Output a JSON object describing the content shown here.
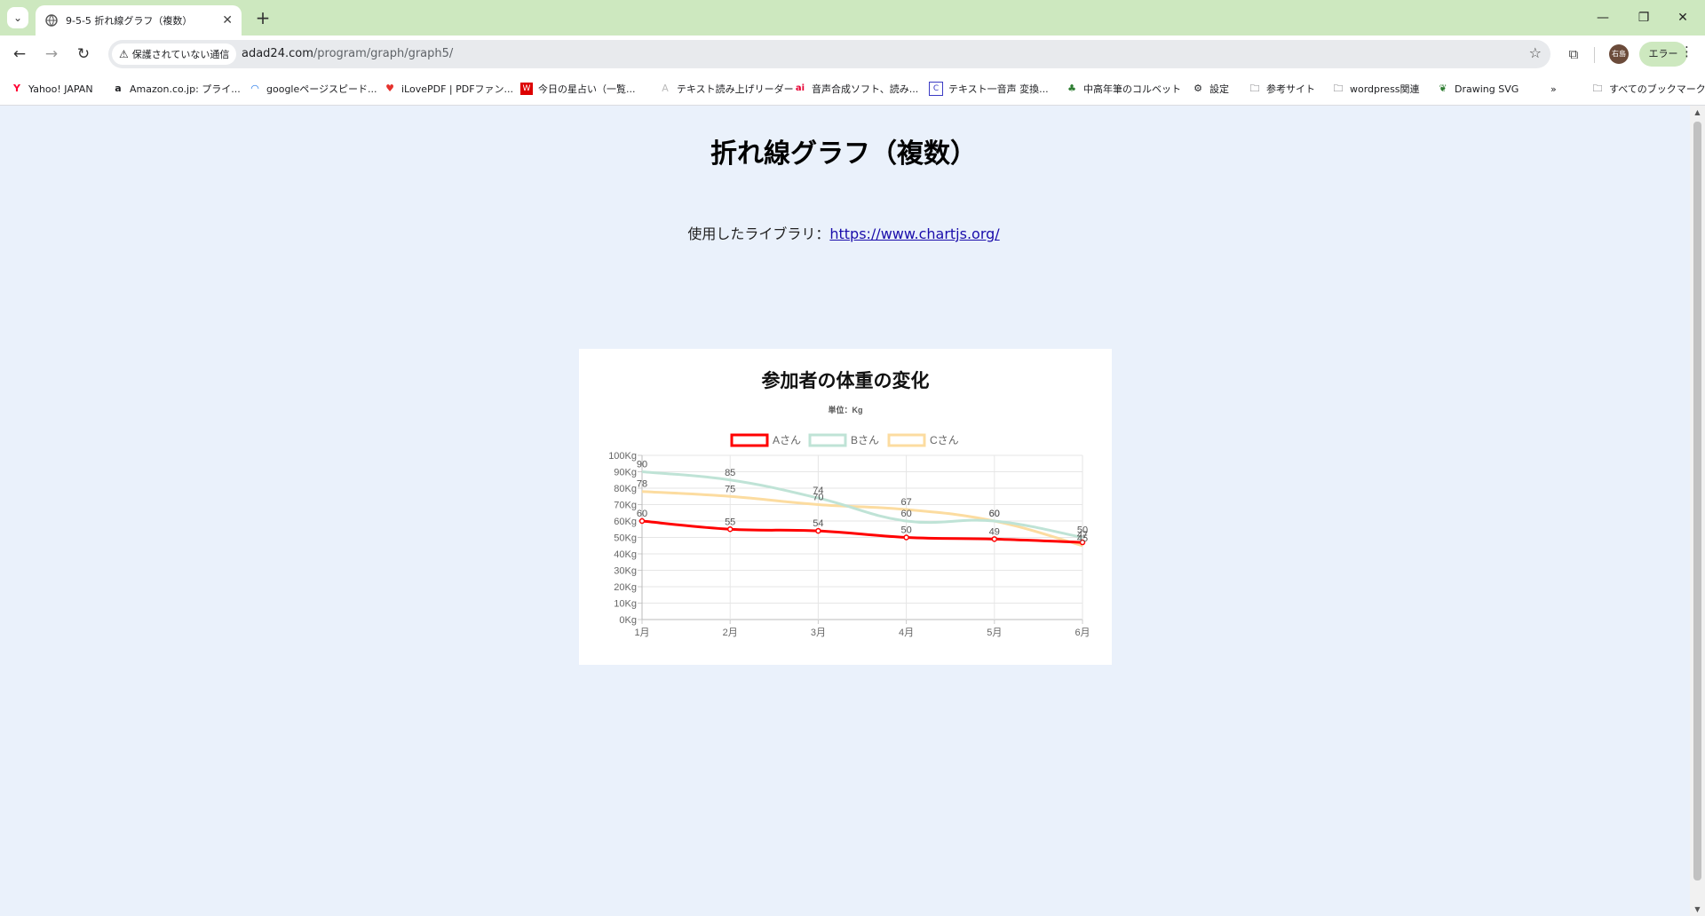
{
  "browser": {
    "tab_title": "9-5-5 折れ線グラフ（複数）",
    "security_label": "保護されていない通信",
    "url_host": "adad24.com",
    "url_path": "/program/graph/graph5/",
    "profile_initials": "右島",
    "error_label": "エラー",
    "bookmarks": [
      {
        "label": "Yahoo! JAPAN",
        "icon": "yahoo-icon"
      },
      {
        "label": "Amazon.co.jp: プライ...",
        "icon": "amazon-icon"
      },
      {
        "label": "googleページスピード...",
        "icon": "pagespeed-icon"
      },
      {
        "label": "iLovePDF | PDFファン...",
        "icon": "heart-icon"
      },
      {
        "label": "今日の星占い（一覧...",
        "icon": "fortune-icon"
      },
      {
        "label": "テキスト読み上げリーダー",
        "icon": "reader-icon"
      },
      {
        "label": "音声合成ソフト、読み...",
        "icon": "ai-icon"
      },
      {
        "label": "テキスト一音声 変換...",
        "icon": "c-icon"
      },
      {
        "label": "中高年筆のコルベット",
        "icon": "frog-icon"
      },
      {
        "label": "設定",
        "icon": "gear-icon"
      },
      {
        "label": "参考サイト",
        "icon": "folder-icon"
      },
      {
        "label": "wordpress関連",
        "icon": "folder-icon"
      },
      {
        "label": "Drawing SVG",
        "icon": "leaf-icon"
      }
    ],
    "all_bookmarks_label": "すべてのブックマーク"
  },
  "page": {
    "title": "折れ線グラフ（複数）",
    "lib_prefix": "使用したライブラリ：",
    "lib_link": "https://www.chartjs.org/"
  },
  "chart_data": {
    "type": "line",
    "title": "参加者の体重の変化",
    "subtitle": "単位：Kg",
    "categories": [
      "1月",
      "2月",
      "3月",
      "4月",
      "5月",
      "6月"
    ],
    "y_ticks": [
      "0Kg",
      "10Kg",
      "20Kg",
      "30Kg",
      "40Kg",
      "50Kg",
      "60Kg",
      "70Kg",
      "80Kg",
      "90Kg",
      "100Kg"
    ],
    "ylim": [
      0,
      100
    ],
    "legend_position": "top",
    "grid": true,
    "series": [
      {
        "name": "Aさん",
        "values": [
          60,
          55,
          54,
          50,
          49,
          47
        ],
        "color": "#ff0000",
        "show_points": true
      },
      {
        "name": "Bさん",
        "values": [
          90,
          85,
          74,
          60,
          60,
          50
        ],
        "color": "#bfe3d6",
        "show_points": false
      },
      {
        "name": "Cさん",
        "values": [
          78,
          75,
          70,
          67,
          60,
          45
        ],
        "color": "#fcdca0",
        "show_points": false
      }
    ]
  }
}
